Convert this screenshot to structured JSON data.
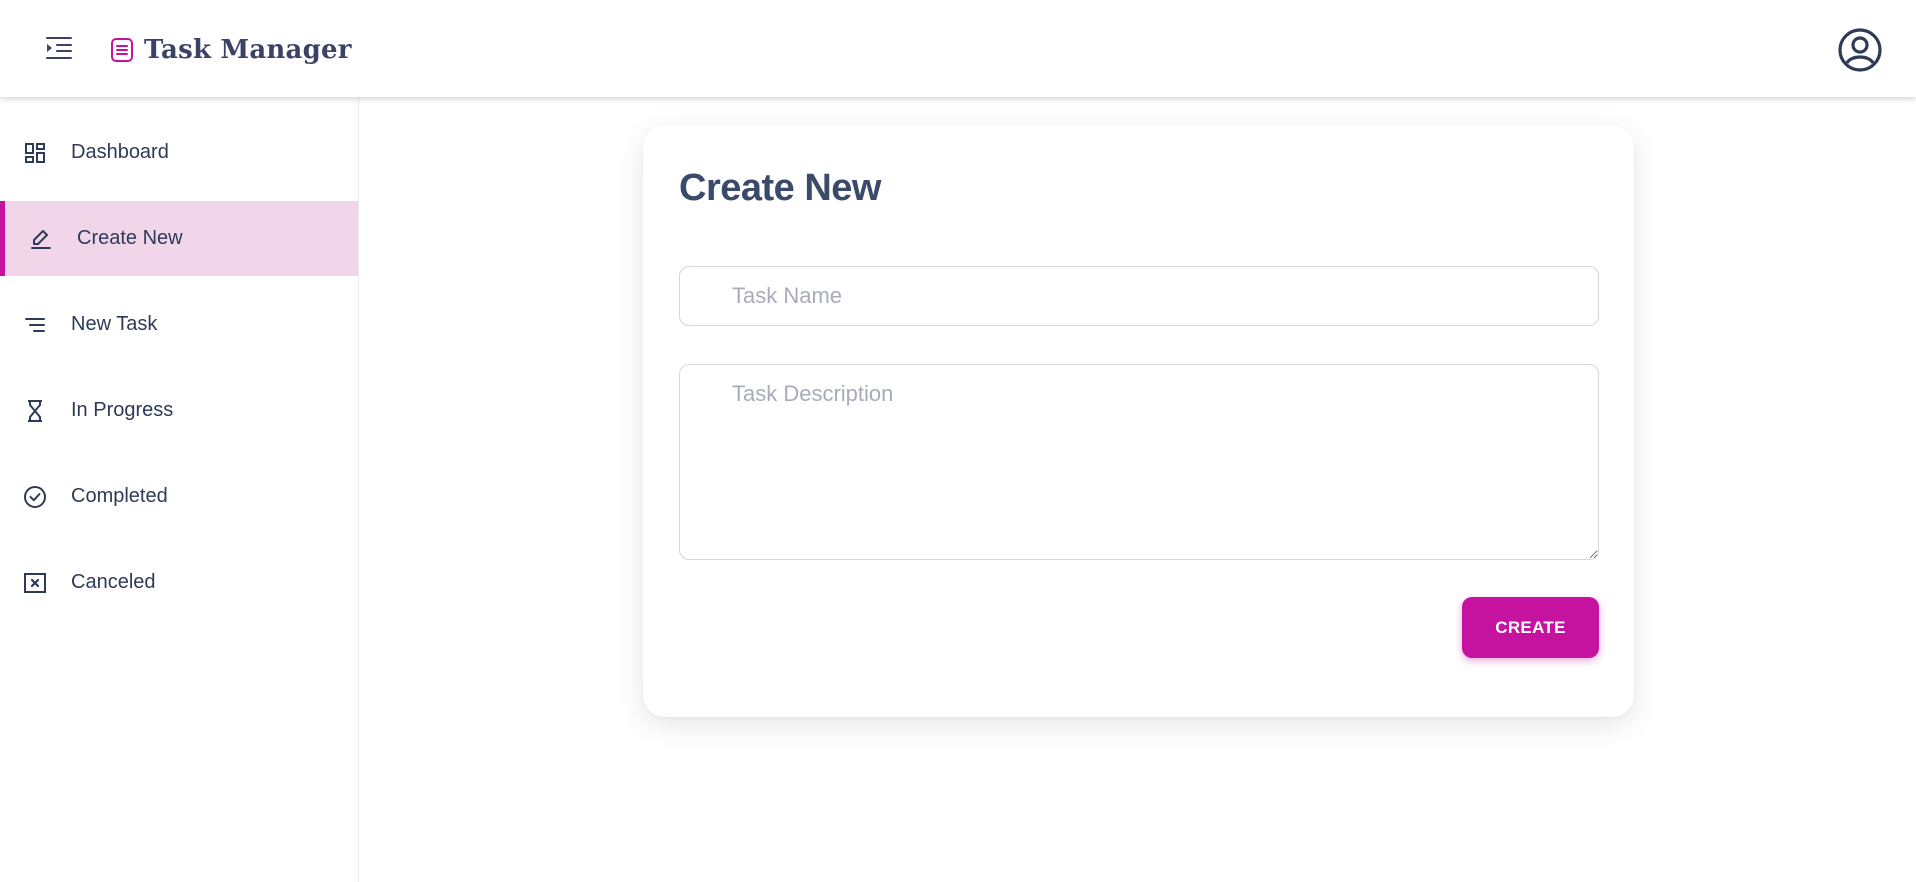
{
  "app": {
    "title": "Task Manager",
    "accent_color": "#c5139f",
    "brand_icon": "list-document-icon",
    "menu_icon": "indent-menu-icon",
    "user_icon": "user-circle-icon"
  },
  "sidebar": {
    "items": [
      {
        "label": "Dashboard",
        "icon": "dashboard-grid-icon",
        "active": false
      },
      {
        "label": "Create New",
        "icon": "pencil-icon",
        "active": true
      },
      {
        "label": "New Task",
        "icon": "lines-icon",
        "active": false
      },
      {
        "label": "In Progress",
        "icon": "hourglass-icon",
        "active": false
      },
      {
        "label": "Completed",
        "icon": "check-circle-icon",
        "active": false
      },
      {
        "label": "Canceled",
        "icon": "x-square-icon",
        "active": false
      }
    ]
  },
  "form": {
    "title": "Create New",
    "task_name_placeholder": "Task Name",
    "task_name_value": "",
    "task_description_placeholder": "Task Description",
    "task_description_value": "",
    "submit_label": "CREATE"
  }
}
